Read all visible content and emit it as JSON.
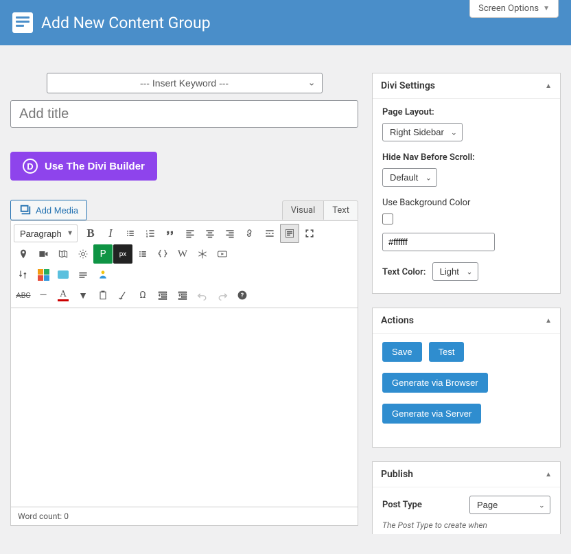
{
  "header": {
    "page_title": "Add New Content Group",
    "screen_options": "Screen Options"
  },
  "main": {
    "keyword_placeholder": "--- Insert Keyword ---",
    "title_placeholder": "Add title",
    "divi_button": "Use The Divi Builder",
    "add_media": "Add Media",
    "tabs": {
      "visual": "Visual",
      "text": "Text"
    },
    "paragraph_label": "Paragraph",
    "word_count_label": "Word count: ",
    "word_count_value": "0"
  },
  "panels": {
    "divi": {
      "title": "Divi Settings",
      "page_layout_label": "Page Layout:",
      "page_layout_value": "Right Sidebar",
      "hide_nav_label": "Hide Nav Before Scroll:",
      "hide_nav_value": "Default",
      "bg_label": "Use Background Color",
      "bg_value": "#ffffff",
      "text_color_label": "Text Color:",
      "text_color_value": "Light"
    },
    "actions": {
      "title": "Actions",
      "save": "Save",
      "test": "Test",
      "gen_browser": "Generate via Browser",
      "gen_server": "Generate via Server"
    },
    "publish": {
      "title": "Publish",
      "post_type_label": "Post Type",
      "post_type_value": "Page",
      "hint": "The Post Type to create when"
    }
  }
}
